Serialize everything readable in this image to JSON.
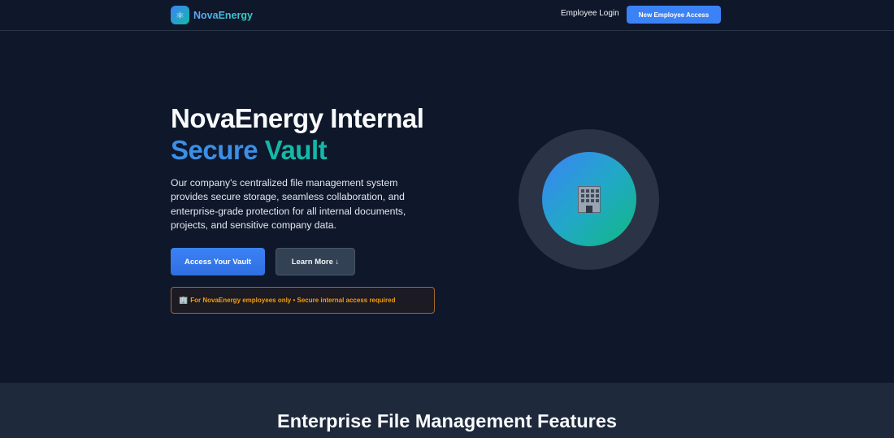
{
  "nav": {
    "brand_name": "NovaEnergy",
    "brand_icon": "atom-icon",
    "brand_icon_glyph": "⚛",
    "login_label": "Employee Login",
    "cta_label": "New Employee Access"
  },
  "hero": {
    "title_line1": "NovaEnergy Internal",
    "title_word1": "Secure",
    "title_word2": "Vault",
    "description": "Our company's centralized file management system provides secure storage, seamless collaboration, and enterprise-grade protection for all internal documents, projects, and sensitive company data.",
    "primary_button": "Access Your Vault",
    "secondary_button": "Learn More ↓",
    "notice_icon": "building-icon",
    "notice_text": "For NovaEnergy employees only • Secure internal access required",
    "illustration_icon": "office-building-icon"
  },
  "features": {
    "title": "Enterprise File Management Features"
  },
  "colors": {
    "background": "#0f172a",
    "accent_blue": "#3b82f6",
    "accent_teal": "#14b8a6",
    "notice_amber": "#f59e0b",
    "section_alt": "#1e293b"
  }
}
